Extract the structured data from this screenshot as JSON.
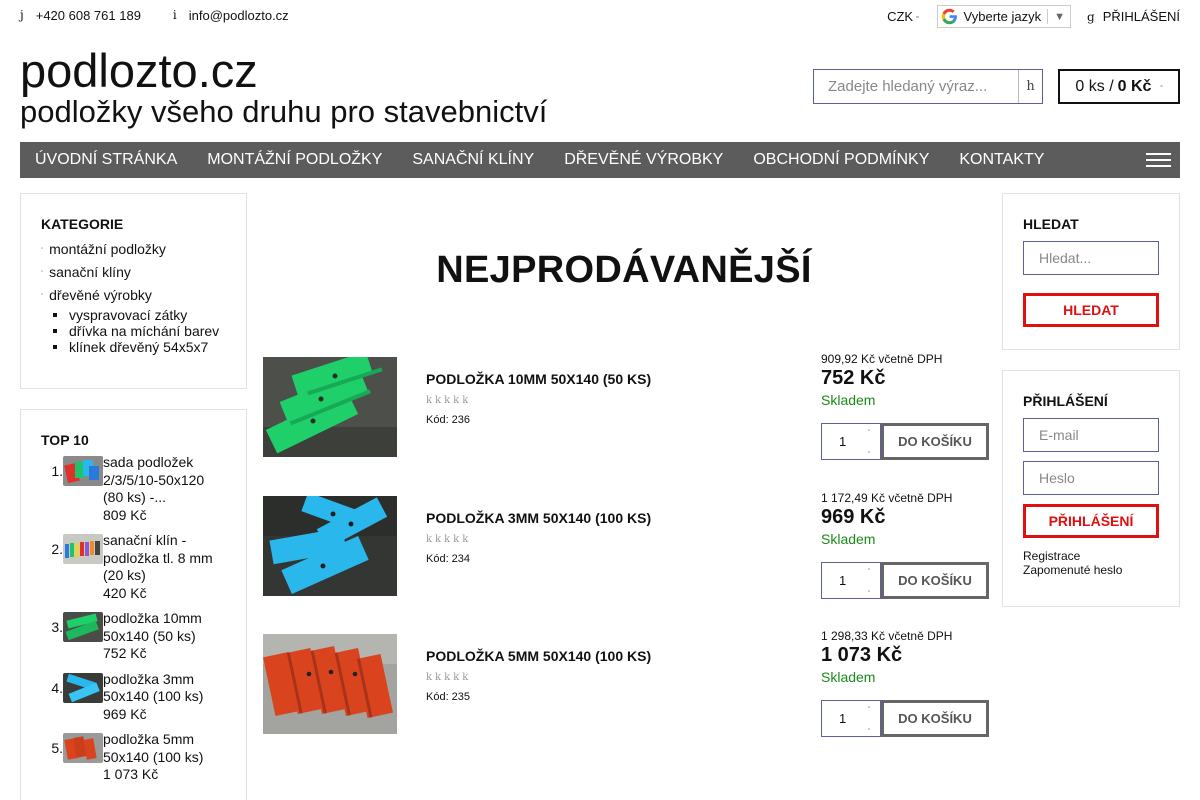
{
  "topbar": {
    "phone_icon": "j",
    "phone": "+420 608 761 189",
    "email_icon": "i",
    "email": "info@podlozto.cz",
    "currency": "CZK",
    "currency_caret": "▫",
    "language_label": "Vyberte jazyk",
    "language_arrow": "▼",
    "login_icon": "g",
    "login_label": "PŘIHLÁŠENÍ"
  },
  "header": {
    "brand": "podlozto.cz",
    "slogan": "podložky všeho druhu pro stavebnictví",
    "search_placeholder": "Zadejte hledaný výraz...",
    "search_button_icon": "h",
    "cart_count": "0 ks /",
    "cart_total": "0 Kč",
    "cart_caret": "▫"
  },
  "nav": {
    "items": [
      "ÚVODNÍ STRÁNKA",
      "MONTÁŽNÍ PODLOŽKY",
      "SANAČNÍ KLÍNY",
      "DŘEVĚNÉ VÝROBKY",
      "OBCHODNÍ PODMÍNKY",
      "KONTAKTY"
    ]
  },
  "categories": {
    "title": "KATEGORIE",
    "items": [
      "montážní podložky",
      "sanační klíny",
      "dřevěné výrobky"
    ],
    "subitems": [
      "vyspravovací zátky",
      "dřívka na míchání barev",
      "klínek dřevěný 54x5x7"
    ]
  },
  "top10": {
    "title": "TOP 10",
    "items": [
      {
        "num": "1.",
        "line1": "sada podložek",
        "line2": "2/3/5/10-50x120",
        "line3": "(80 ks) -...",
        "price": "809 Kč"
      },
      {
        "num": "2.",
        "line1": "sanační klín -",
        "line2": "podložka tl. 8 mm",
        "line3": "(20 ks)",
        "price": "420 Kč"
      },
      {
        "num": "3.",
        "line1": "podložka 10mm",
        "line2": "50x140 (50 ks)",
        "line3": "",
        "price": "752 Kč"
      },
      {
        "num": "4.",
        "line1": "podložka 3mm",
        "line2": "50x140 (100 ks)",
        "line3": "",
        "price": "969 Kč"
      },
      {
        "num": "5.",
        "line1": "podložka 5mm",
        "line2": "50x140 (100 ks)",
        "line3": "",
        "price": "1 073 Kč"
      }
    ]
  },
  "main": {
    "title": "NEJPRODÁVANĚJŠÍ",
    "products": [
      {
        "name": "PODLOŽKA 10MM 50X140 (50 KS)",
        "stars": "kkkkk",
        "code": "Kód: 236",
        "vat": "909,92 Kč včetně DPH",
        "price": "752 Kč",
        "stock": "Skladem",
        "qty": "1",
        "add": "DO KOŠÍKU",
        "color": "#1fcf6a"
      },
      {
        "name": "PODLOŽKA 3MM 50X140 (100 KS)",
        "stars": "kkkkk",
        "code": "Kód: 234",
        "vat": "1 172,49 Kč včetně DPH",
        "price": "969 Kč",
        "stock": "Skladem",
        "qty": "1",
        "add": "DO KOŠÍKU",
        "color": "#2ab8ec"
      },
      {
        "name": "PODLOŽKA 5MM 50X140 (100 KS)",
        "stars": "kkkkk",
        "code": "Kód: 235",
        "vat": "1 298,33 Kč včetně DPH",
        "price": "1 073 Kč",
        "stock": "Skladem",
        "qty": "1",
        "add": "DO KOŠÍKU",
        "color": "#d9441e"
      }
    ]
  },
  "search_panel": {
    "title": "HLEDAT",
    "placeholder": "Hledat...",
    "button": "HLEDAT"
  },
  "login_panel": {
    "title": "PŘIHLÁŠENÍ",
    "email_placeholder": "E-mail",
    "password_placeholder": "Heslo",
    "button": "PŘIHLÁŠENÍ",
    "register": "Registrace",
    "forgot": "Zapomenuté heslo"
  },
  "colors": {
    "nav_bg": "#5c5c5c",
    "accent_red": "#e01010",
    "stock_green": "#1a8a1a"
  }
}
